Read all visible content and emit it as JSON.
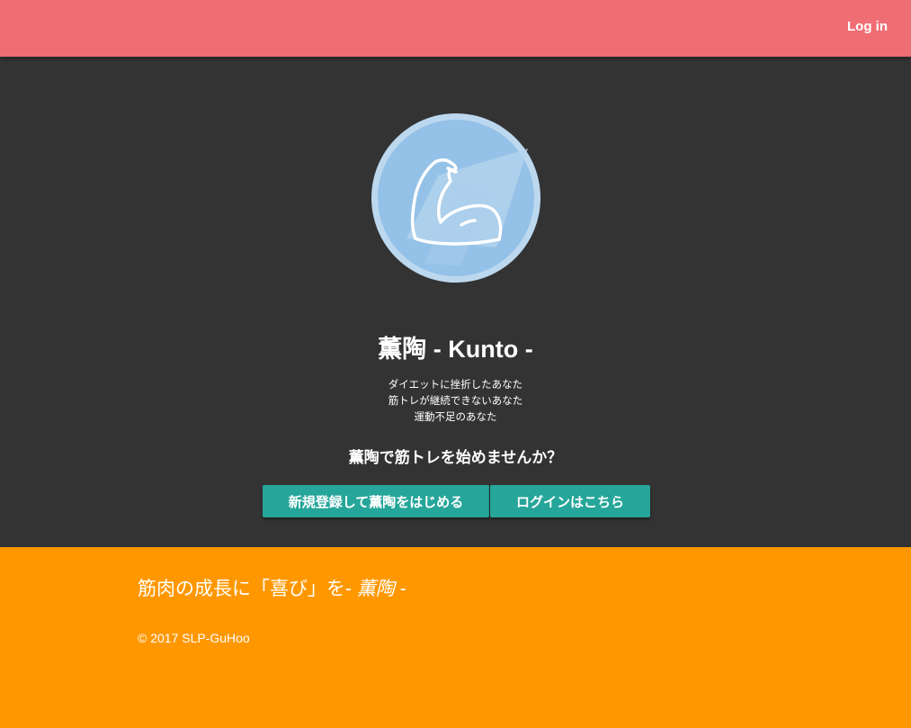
{
  "navbar": {
    "login_label": "Log in",
    "color": "#ef6e74"
  },
  "hero": {
    "logo_icon": "flexed-bicep-icon",
    "title": "薫陶 - Kunto -",
    "taglines": [
      "ダイエットに挫折したあなた",
      "筋トレが継続できないあなた",
      "運動不足のあなた"
    ],
    "cta_heading": "薫陶で筋トレを始めませんか？",
    "register_button": "新規登録して薫陶をはじめる",
    "login_button": "ログインはこちら",
    "background": "#333333",
    "button_color": "#26a69a"
  },
  "footer": {
    "slogan_prefix": "筋肉の成長に「喜び」を- ",
    "slogan_brand": "薫陶",
    "slogan_suffix": " -",
    "copyright": "© 2017 SLP-GuHoo",
    "background": "#ff9800"
  }
}
